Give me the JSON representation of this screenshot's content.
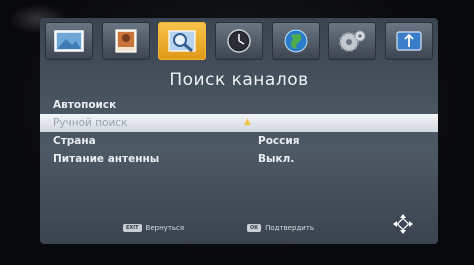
{
  "menu": {
    "tabs": [
      {
        "icon": "picture-icon",
        "active": false
      },
      {
        "icon": "photo-icon",
        "active": false
      },
      {
        "icon": "magnifier-search-icon",
        "active": true
      },
      {
        "icon": "clock-icon",
        "active": false
      },
      {
        "icon": "globe-icon",
        "active": false
      },
      {
        "icon": "gears-icon",
        "active": false
      },
      {
        "icon": "usb-icon",
        "active": false
      }
    ],
    "title": "Поиск каналов",
    "rows": [
      {
        "label": "Автопоиск",
        "value": ""
      },
      {
        "label": "Ручной поиск",
        "value": ""
      },
      {
        "label": "Страна",
        "value": "Россия"
      },
      {
        "label": "Питание антенны",
        "value": "Выкл."
      }
    ],
    "selected_row": 1
  },
  "footer": {
    "back_key": "EXIT",
    "back_label": "Вернуться",
    "ok_key": "OK",
    "ok_label": "Подтвердить",
    "nav_icon": "direction-pad-icon"
  },
  "colors": {
    "active_tab": "#f2b338",
    "selection": "#eef1f4",
    "screen_bg": "#4a5562"
  }
}
